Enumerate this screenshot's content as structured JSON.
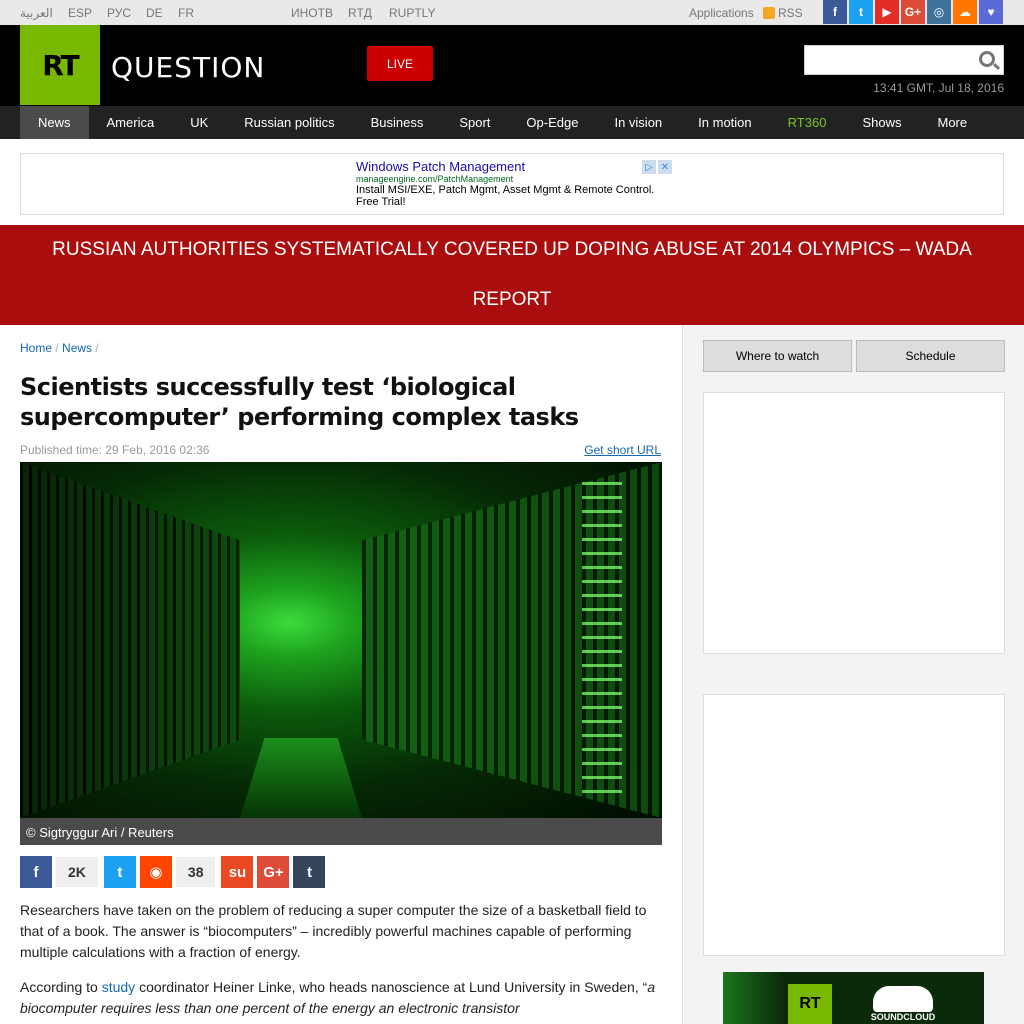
{
  "topbar": {
    "languages": [
      "العربية",
      "ESP",
      "РУС",
      "DE",
      "FR"
    ],
    "partners": [
      "ИНОТВ",
      "RTД",
      "RUPTLY"
    ],
    "applications": "Applications",
    "rss": "RSS",
    "social": [
      {
        "icon": "facebook-icon",
        "glyph": "f",
        "color": "#3b5998"
      },
      {
        "icon": "twitter-icon",
        "glyph": "t",
        "color": "#1da1f2"
      },
      {
        "icon": "youtube-icon",
        "glyph": "▶",
        "color": "#e52d27"
      },
      {
        "icon": "google-plus-icon",
        "glyph": "G+",
        "color": "#dd4b39"
      },
      {
        "icon": "instagram-icon",
        "glyph": "◎",
        "color": "#3f729b"
      },
      {
        "icon": "soundcloud-icon",
        "glyph": "☁",
        "color": "#ff7700"
      },
      {
        "icon": "extra-social-icon",
        "glyph": "♥",
        "color": "#5a6bd6"
      }
    ]
  },
  "header": {
    "logo_text": "RT",
    "section_title": "QUESTION",
    "live_label": "LIVE",
    "search_placeholder": "",
    "datetime": "13:41 GMT, Jul 18, 2016"
  },
  "nav": {
    "items": [
      "News",
      "America",
      "UK",
      "Russian politics",
      "Business",
      "Sport",
      "Op-Edge",
      "In vision",
      "In motion",
      "RT360",
      "Shows",
      "More"
    ],
    "active": "News",
    "highlight": "RT360",
    "highlight_color": "#7ec22f"
  },
  "ad": {
    "title": "Windows Patch Management",
    "url": "manageengine.com/PatchManagement",
    "description": "Install MSI/EXE, Patch Mgmt, Asset Mgmt & Remote Control. Free Trial!"
  },
  "breaking": {
    "text": "RUSSIAN AUTHORITIES SYSTEMATICALLY COVERED UP DOPING ABUSE AT 2014 OLYMPICS – WADA REPORT",
    "color": "#a90d0d"
  },
  "article": {
    "breadcrumb": [
      "Home",
      "News"
    ],
    "title": "Scientists successfully test ‘biological supercomputer’ performing complex tasks",
    "published": "Published time: 29 Feb, 2016 02:36",
    "short_url": "Get short URL",
    "photo_caption": "© Sigtryggur Ari / Reuters",
    "shares": {
      "facebook_count": "2K",
      "reddit_count": "38"
    },
    "paragraph1": "Researchers have taken on the problem of reducing a super computer the size of a basketball field to that of a book. The answer is “biocomputers” – incredibly powerful machines capable of performing multiple calculations with a fraction of energy.",
    "paragraph2_prefix": "According to ",
    "paragraph2_link": "study",
    "paragraph2_mid": " coordinator Heiner Linke, who heads nanoscience at Lund University in Sweden, “",
    "paragraph2_quote": "a biocomputer requires less than one percent of the energy an electronic transistor"
  },
  "sidebar": {
    "where_to_watch": "Where to watch",
    "schedule": "Schedule",
    "promo_logo": "RT",
    "promo_text": "SOUNDCLOUD"
  }
}
